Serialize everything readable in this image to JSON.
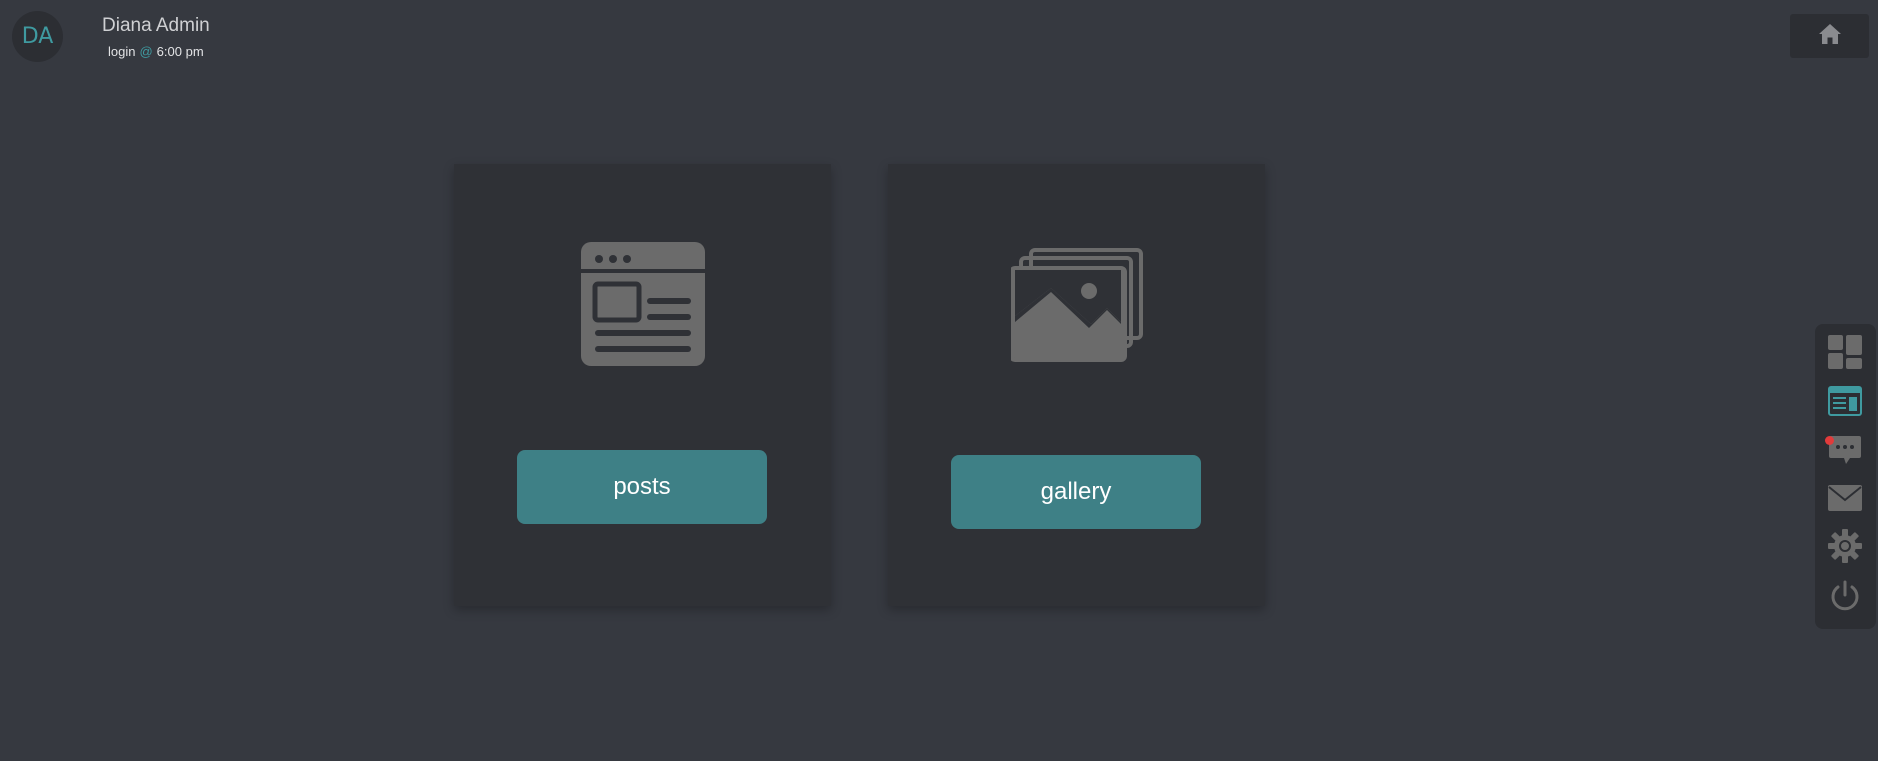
{
  "user": {
    "initials": "DA",
    "name": "Diana Admin",
    "login_label": "login",
    "at_symbol": "@",
    "login_time": "6:00 pm"
  },
  "header": {
    "home_icon": "home-icon"
  },
  "cards": [
    {
      "icon": "news-article-icon",
      "button_label": "posts"
    },
    {
      "icon": "image-gallery-icon",
      "button_label": "gallery"
    }
  ],
  "side_nav": {
    "items": [
      {
        "icon": "dashboard-icon",
        "active": false
      },
      {
        "icon": "posts-icon",
        "active": true
      },
      {
        "icon": "chat-icon",
        "active": false,
        "notification": true
      },
      {
        "icon": "mail-icon",
        "active": false
      },
      {
        "icon": "settings-icon",
        "active": false
      },
      {
        "icon": "power-icon",
        "active": false
      }
    ]
  },
  "colors": {
    "background": "#363940",
    "panel": "#2f3136",
    "accent": "#3e8086",
    "accent_text": "#3f9aa0",
    "icon_gray": "#6b6b6b",
    "notification": "#e23b3b"
  }
}
